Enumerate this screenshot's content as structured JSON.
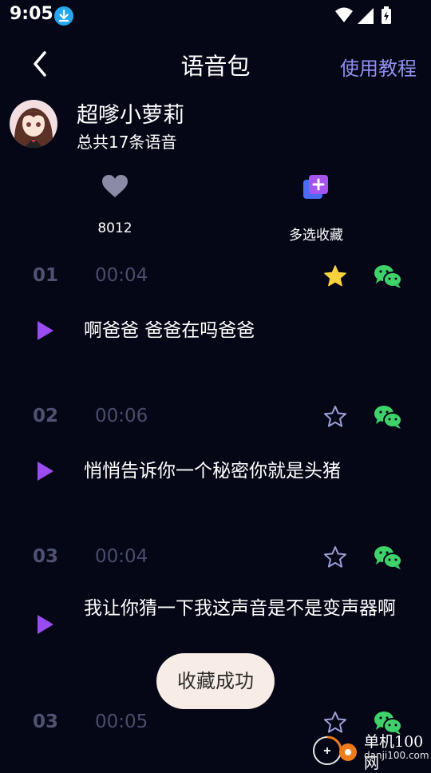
{
  "status_bar": {
    "time": "9:05"
  },
  "nav": {
    "title": "语音包",
    "tutorial_link": "使用教程"
  },
  "pack": {
    "name": "超嗲小萝莉",
    "count_text": "总共17条语音"
  },
  "stats": {
    "likes": "8012",
    "multi_favorite": "多选收藏"
  },
  "items": [
    {
      "index": "01",
      "duration": "00:04",
      "text": "啊爸爸 爸爸在吗爸爸",
      "starred": true
    },
    {
      "index": "02",
      "duration": "00:06",
      "text": "悄悄告诉你一个秘密你就是头猪",
      "starred": false
    },
    {
      "index": "03",
      "duration": "00:04",
      "text": "我让你猜一下我这声音是不是变声器啊",
      "starred": false
    },
    {
      "index": "03",
      "duration": "00:05",
      "text": "",
      "starred": false
    }
  ],
  "toast": {
    "text": "收藏成功"
  },
  "watermark": {
    "site_name": "单机100网",
    "site_url": "danji100.com"
  },
  "colors": {
    "background": "#050716",
    "accent_purple": "#8f8ff0",
    "star_active": "#f8d23c",
    "wechat_green": "#3ed36a",
    "play_purple": "#9b4cf0"
  }
}
